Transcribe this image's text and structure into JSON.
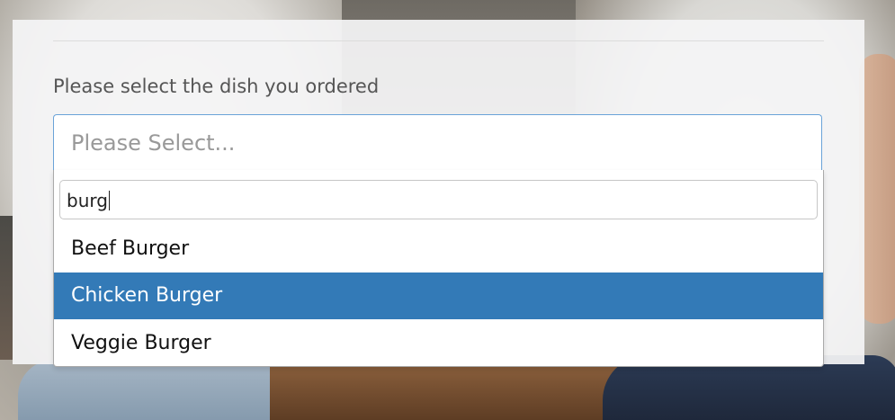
{
  "form": {
    "field_label": "Please select the dish you ordered",
    "select_placeholder": "Please Select...",
    "search_value": "burg",
    "options": [
      {
        "label": "Beef Burger",
        "highlighted": false
      },
      {
        "label": "Chicken Burger",
        "highlighted": true
      },
      {
        "label": "Veggie Burger",
        "highlighted": false
      }
    ]
  },
  "colors": {
    "highlight": "#337ab7",
    "focus_border": "#6aa3d8",
    "label_text": "#555555",
    "placeholder_text": "#999999"
  }
}
